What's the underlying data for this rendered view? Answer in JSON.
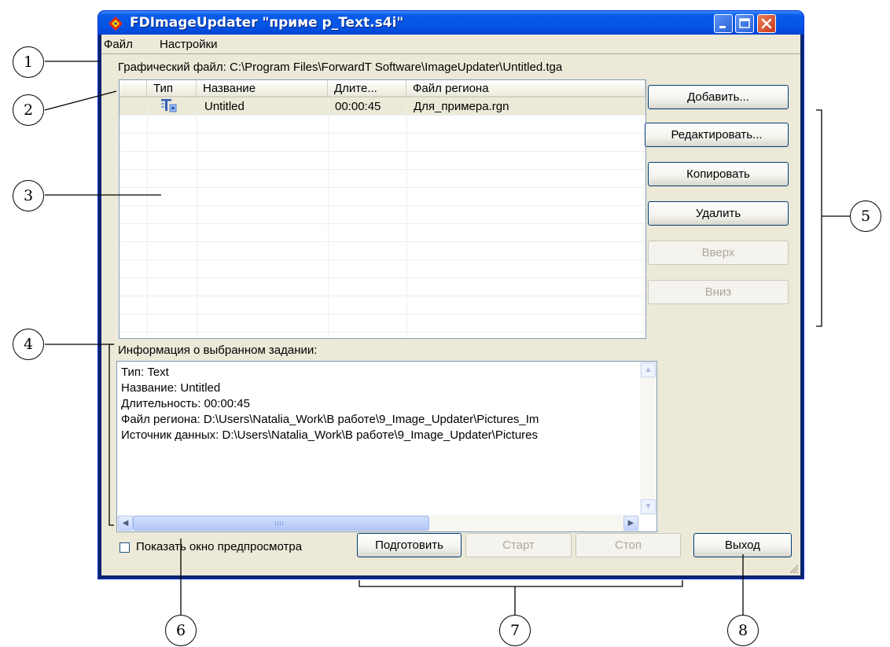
{
  "window": {
    "title": "FDImageUpdater \"приме р_Text.s4i\"",
    "icon": "diamond-app-icon"
  },
  "menu": {
    "items": [
      "Файл",
      "Настройки"
    ]
  },
  "graphic_file": {
    "text": "Графический файл: C:\\Program Files\\ForwardT Software\\ImageUpdater\\Untitled.tga"
  },
  "tasks": {
    "columns": [
      "",
      "Тип",
      "Название",
      "Длите...",
      "Файл региона"
    ],
    "rows": [
      {
        "type_icon": "text-task-icon",
        "name": "Untitled",
        "duration": "00:00:45",
        "region_file": "Для_примера.rgn",
        "selected": true
      }
    ]
  },
  "side_buttons": {
    "add": "Добавить...",
    "edit": "Редактировать...",
    "copy": "Копировать",
    "delete": "Удалить",
    "up": "Вверх",
    "down": "Вниз"
  },
  "info": {
    "label": "Информация о выбранном задании:",
    "lines": [
      "Тип: Text",
      "Название: Untitled",
      "Длительность: 00:00:45",
      "Файл региона: D:\\Users\\Natalia_Work\\В работе\\9_Image_Updater\\Pictures_Im",
      "Источник данных: D:\\Users\\Natalia_Work\\В работе\\9_Image_Updater\\Pictures"
    ]
  },
  "preview": {
    "label": "Показать окно предпросмотра",
    "checked": false
  },
  "bottom_buttons": {
    "prepare": "Подготовить",
    "start": "Старт",
    "stop": "Стоп",
    "exit": "Выход"
  },
  "callouts": [
    "1",
    "2",
    "3",
    "4",
    "5",
    "6",
    "7",
    "8"
  ],
  "colors": {
    "titlebar": "#0556E6",
    "client": "#ECE9D8",
    "close_button": "#C8391A"
  }
}
